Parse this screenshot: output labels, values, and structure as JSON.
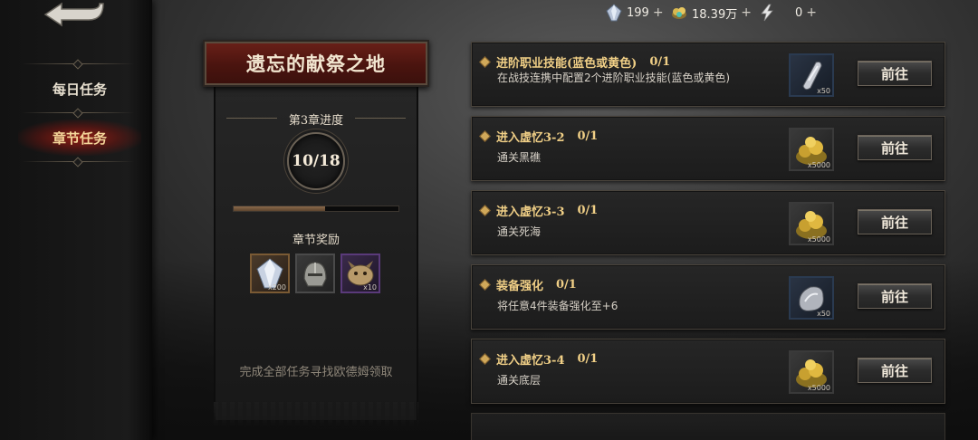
{
  "resources": [
    {
      "icon": "crystal-icon",
      "value": "199"
    },
    {
      "icon": "gold-coin-icon",
      "value": "18.39万"
    },
    {
      "icon": "lightning-icon",
      "value": "0"
    }
  ],
  "plus_label": "+",
  "sidebar": {
    "items": [
      {
        "label": "每日任务",
        "active": false
      },
      {
        "label": "章节任务",
        "active": true
      }
    ]
  },
  "banner": {
    "title": "遗忘的献祭之地",
    "chapter_label": "第3章进度",
    "progress_text": "10/18",
    "progress_fraction": 0.556,
    "rewards_label": "章节奖励",
    "rewards": [
      {
        "icon": "crystal-icon",
        "qty": "x200"
      },
      {
        "icon": "helmet-icon",
        "qty": ""
      },
      {
        "icon": "beast-head-icon",
        "qty": "x10"
      }
    ],
    "hint": "完成全部任务寻找欧德姆领取"
  },
  "go_label": "前往",
  "tasks": [
    {
      "title": "进阶职业技能(蓝色或黄色)",
      "count": "0/1",
      "desc": "在战技连携中配置2个进阶职业技能(蓝色或黄色)",
      "reward_icon": "metal-ingot-icon",
      "reward_qty": "x50"
    },
    {
      "title": "进入虚忆3-2",
      "count": "0/1",
      "desc": "通关黑礁",
      "reward_icon": "gold-pile-icon",
      "reward_qty": "x5000"
    },
    {
      "title": "进入虚忆3-3",
      "count": "0/1",
      "desc": "通关死海",
      "reward_icon": "gold-pile-icon",
      "reward_qty": "x5000"
    },
    {
      "title": "装备强化",
      "count": "0/1",
      "desc": "将任意4件装备强化至+6",
      "reward_icon": "ore-icon",
      "reward_qty": "x50"
    },
    {
      "title": "进入虚忆3-4",
      "count": "0/1",
      "desc": "通关底层",
      "reward_icon": "gold-pile-icon",
      "reward_qty": "x5000"
    }
  ]
}
